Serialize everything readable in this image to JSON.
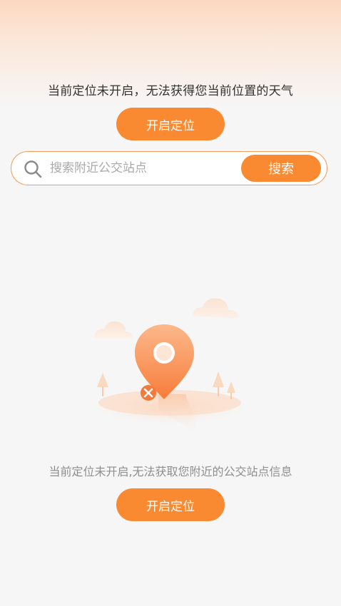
{
  "weather": {
    "message": "当前定位未开启，无法获得您当前位置的天气",
    "enable_button": "开启定位"
  },
  "search": {
    "placeholder": "搜索附近公交站点",
    "button_label": "搜索"
  },
  "stations": {
    "message": "当前定位未开启,无法获取您附近的公交站点信息",
    "enable_button": "开启定位"
  },
  "colors": {
    "accent": "#fa8a32",
    "search_border": "#f39a57",
    "background": "#f6f6f6"
  }
}
